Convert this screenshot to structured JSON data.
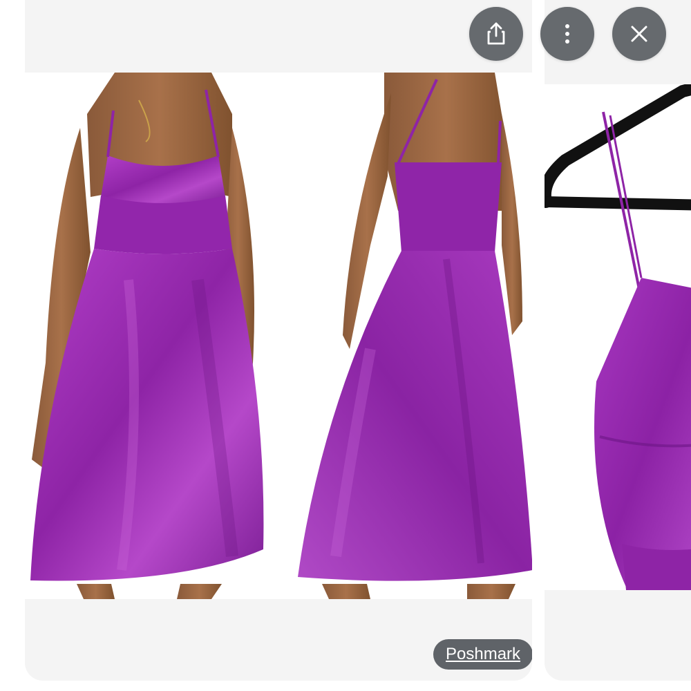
{
  "viewer": {
    "source_label": "Poshmark",
    "actions": {
      "share": "share-icon",
      "more": "more-vertical-icon",
      "close": "close-icon"
    }
  },
  "colors": {
    "dress": "#9b2fb0",
    "button_bg": "#666a6e",
    "card_bg": "#f4f4f4"
  }
}
